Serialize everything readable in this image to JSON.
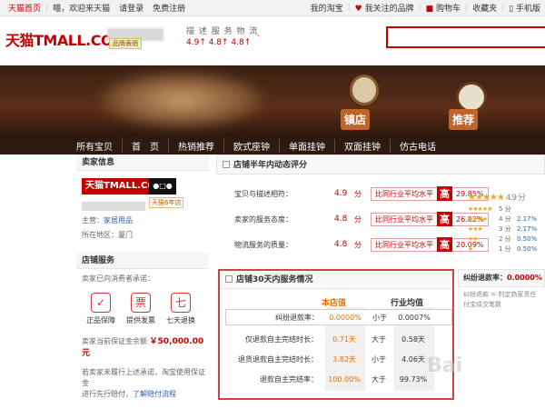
{
  "topbar": {
    "home": "天猫首页",
    "greeting": "喵，欢迎来天猫",
    "login": "请登录",
    "register": "免费注册",
    "my_taobao": "我的淘宝",
    "fav_brands": "我关注的品牌",
    "cart": "购物车",
    "favorites": "收藏夹",
    "mobile": "手机版"
  },
  "header": {
    "logo": "天猫TMALL.COM",
    "badge": "品牌表晒",
    "rating_title": "描 述 服 务 物 流",
    "rating_values": "4.9↑ 4.8↑ 4.8↑"
  },
  "banner": {
    "btn_shop": "镇店",
    "btn_recommend": "推荐"
  },
  "nav": [
    "所有宝贝",
    "首　页",
    "热销推荐",
    "欧式座钟",
    "单面挂钟",
    "双面挂钟",
    "仿古电话"
  ],
  "seller": {
    "section_title": "卖家信息",
    "logo_text": "天猫TMALL.COM",
    "years_badge": "天猫6年店",
    "main_label": "主营：",
    "main_value": "家居用品",
    "region_label": "所在地区：",
    "region_value": "厦门"
  },
  "services": {
    "section_title": "店铺服务",
    "promise": "卖家已向消费者承诺：",
    "items": [
      {
        "label": "正品保障",
        "icon": "✓"
      },
      {
        "label": "提供发票",
        "icon": "票"
      },
      {
        "label": "七天退换",
        "icon": "七"
      }
    ],
    "deposit_label": "卖家当前保证金余额",
    "deposit_value": "￥50,000.00 元",
    "notice1": "若卖家未履行上述承诺，淘宝使用保证金",
    "notice2": "进行先行赔付",
    "notice_link": "了解赔付流程"
  },
  "dsr": {
    "title": "店铺半年内动态评分",
    "rows": [
      {
        "label": "宝贝与描述相符：",
        "score": "4.9",
        "unit": "分",
        "compare": "比同行业平均水平",
        "level": "高",
        "pct": "29.85%"
      },
      {
        "label": "卖家的服务态度：",
        "score": "4.8",
        "unit": "分",
        "compare": "比同行业平均水平",
        "level": "高",
        "pct": "26.82%"
      },
      {
        "label": "物流服务的质量：",
        "score": "4.8",
        "unit": "分",
        "compare": "比同行业平均水平",
        "level": "高",
        "pct": "20.09%"
      }
    ],
    "star_score": "4.9 分",
    "distribution": [
      {
        "stars": "★★★★★",
        "n": "5 分",
        "pct": ""
      },
      {
        "stars": "★★★★",
        "n": "4 分",
        "pct": "2.17%"
      },
      {
        "stars": "★★★",
        "n": "3 分",
        "pct": "2.17%"
      },
      {
        "stars": "★★",
        "n": "2 分",
        "pct": "0.50%"
      },
      {
        "stars": "★",
        "n": "1 分",
        "pct": "0.50%"
      }
    ]
  },
  "service30": {
    "title": "店铺30天内服务情况",
    "col_shop": "本店值",
    "col_industry": "行业均值",
    "rows": [
      {
        "label": "纠纷退款率：",
        "shop": "0.0000%",
        "cmp": "小于",
        "ind": "0.0007%"
      },
      {
        "label": "仅退款自主完结时长：",
        "shop": "0.71天",
        "cmp": "大于",
        "ind": "0.58天"
      },
      {
        "label": "退货退款自主完结时长：",
        "shop": "3.82天",
        "cmp": "小于",
        "ind": "4.06天"
      },
      {
        "label": "退款自主完结率：",
        "shop": "100.00%",
        "cmp": "大于",
        "ind": "99.73%"
      }
    ]
  },
  "refund": {
    "label": "纠纷退款率：",
    "value": "0.0000%",
    "desc1": "纠纷退款 = 判定商家责任",
    "desc2": "付宝成交笔数"
  },
  "watermark": "Bai"
}
